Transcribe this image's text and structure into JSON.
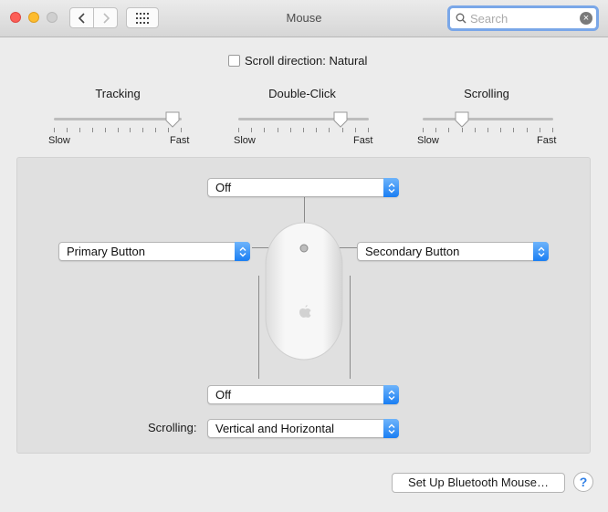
{
  "window": {
    "title": "Mouse"
  },
  "search": {
    "placeholder": "Search",
    "value": ""
  },
  "scroll_direction": {
    "label": "Scroll direction: Natural",
    "checked": false
  },
  "sliders": [
    {
      "title": "Tracking",
      "min_label": "Slow",
      "max_label": "Fast",
      "value": 0.93
    },
    {
      "title": "Double-Click",
      "min_label": "Slow",
      "max_label": "Fast",
      "value": 0.78
    },
    {
      "title": "Scrolling",
      "min_label": "Slow",
      "max_label": "Fast",
      "value": 0.3
    }
  ],
  "mouse_panel": {
    "top_popup": "Off",
    "left_popup": "Primary Button",
    "right_popup": "Secondary Button",
    "bottom_popup": "Off",
    "scrolling_label": "Scrolling:",
    "scrolling_popup": "Vertical and Horizontal"
  },
  "footer": {
    "setup_button": "Set Up Bluetooth Mouse…",
    "help": "?"
  },
  "colors": {
    "accent": "#1a7ef3",
    "close": "#fc5f57",
    "minimize": "#fdbc2e"
  }
}
